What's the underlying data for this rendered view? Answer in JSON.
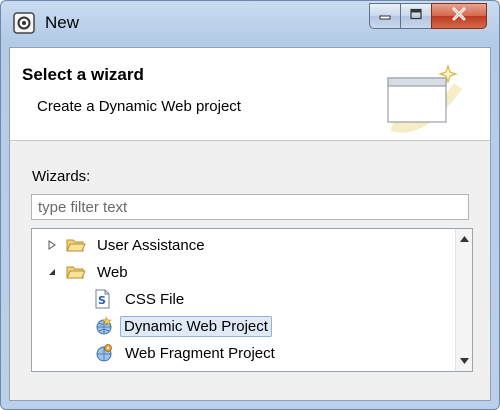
{
  "window": {
    "title": "New",
    "icon": "eclipse-app-icon",
    "controls": {
      "minimize_icon": "minimize-icon",
      "maximize_icon": "maximize-icon",
      "close_icon": "close-icon"
    }
  },
  "header": {
    "title": "Select a wizard",
    "description": "Create a Dynamic Web project",
    "banner_icon": "wizard-banner-icon"
  },
  "wizards": {
    "label": "Wizards:",
    "filter": {
      "value": "",
      "placeholder": "type filter text"
    },
    "tree": [
      {
        "label": "User Assistance",
        "expanded": false,
        "icon": "folder-icon",
        "level": 0
      },
      {
        "label": "Web",
        "expanded": true,
        "icon": "folder-icon",
        "level": 0
      },
      {
        "label": "CSS File",
        "icon": "css-file-icon",
        "level": 1
      },
      {
        "label": "Dynamic Web Project",
        "icon": "web-project-icon",
        "level": 1,
        "selected": true
      },
      {
        "label": "Web Fragment Project",
        "icon": "web-fragment-project-icon",
        "level": 1
      }
    ]
  },
  "colors": {
    "title_bar": "#c9dcf1",
    "close_button": "#c0391f",
    "selection_fill": "#dfe9f7",
    "selection_border": "#8fb2e0",
    "body_background": "#f0f0f0"
  }
}
